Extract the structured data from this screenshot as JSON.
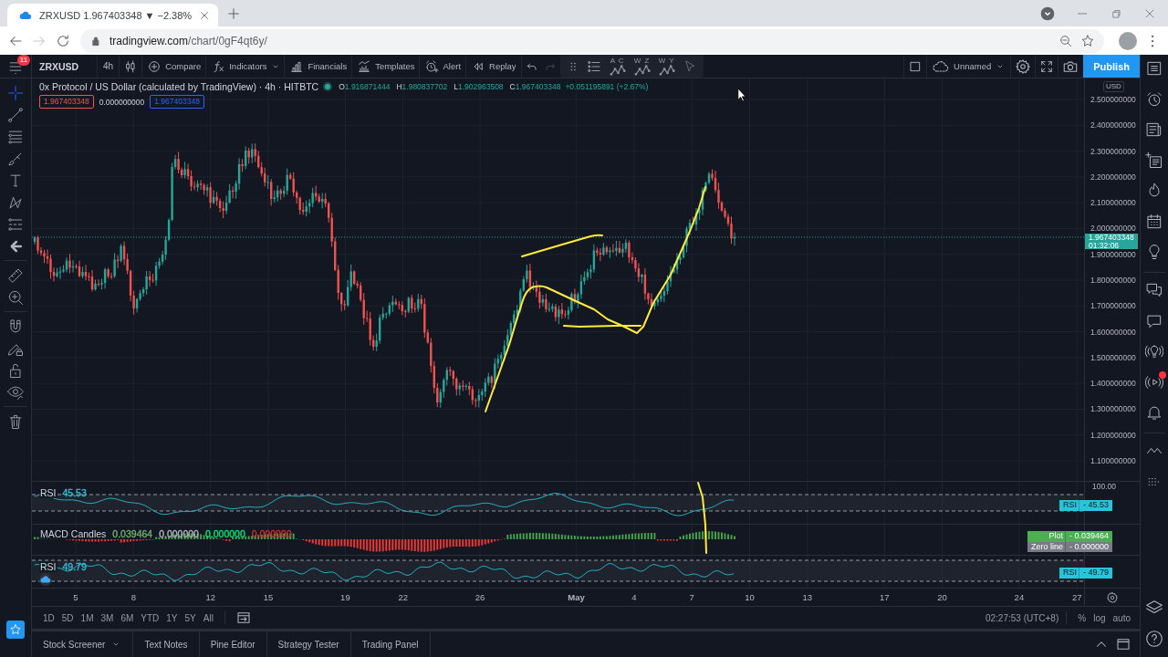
{
  "browser": {
    "tab": {
      "title": "ZRXUSD 1.967403348 ▼ −2.38%"
    },
    "nav": [
      {
        "kind": "back",
        "disabled": false
      },
      {
        "kind": "forward",
        "disabled": true
      },
      {
        "kind": "reload",
        "disabled": false
      }
    ],
    "url": {
      "host": "tradingview.com",
      "path": "/chart/0gF4qt6y/"
    }
  },
  "menu": {
    "badge": "11"
  },
  "left_tools": [
    {
      "tools": [
        {
          "kind": "crosshair",
          "selected": true
        },
        {
          "kind": "trend-line",
          "selected": false
        },
        {
          "kind": "horizontal-lines",
          "selected": false
        },
        {
          "kind": "brush",
          "selected": false
        },
        {
          "kind": "text-tool",
          "selected": false
        },
        {
          "kind": "zigzag-pattern",
          "selected": false
        },
        {
          "kind": "parallel-lines",
          "selected": false
        },
        {
          "kind": "arrow-left",
          "selected": false
        }
      ]
    },
    {
      "tools": [
        {
          "kind": "ruler",
          "selected": false
        },
        {
          "kind": "zoom-in",
          "selected": false
        }
      ]
    },
    {
      "tools": [
        {
          "kind": "magnet",
          "selected": false
        },
        {
          "kind": "pencil-lock",
          "selected": false
        },
        {
          "kind": "open-padlock",
          "selected": false
        },
        {
          "kind": "eye",
          "selected": false
        }
      ]
    },
    {
      "tools": [
        {
          "kind": "trash",
          "selected": false
        }
      ]
    }
  ],
  "favorites": {
    "on": true
  },
  "toolbar": {
    "symbol": "ZRXUSD",
    "interval": "4h",
    "actions": [
      {
        "kind": "compare",
        "label": "Compare",
        "dropdown": false
      },
      {
        "kind": "indicators",
        "label": "Indicators",
        "dropdown": true
      },
      {
        "kind": "financials",
        "label": "Financials",
        "dropdown": false
      },
      {
        "kind": "templates",
        "label": "Templates",
        "dropdown": false
      },
      {
        "kind": "alert",
        "label": "Alert",
        "dropdown": false
      },
      {
        "kind": "replay",
        "label": "Replay",
        "dropdown": false
      }
    ],
    "undo": {
      "disabled": false
    },
    "redo": {
      "disabled": true
    },
    "patterns": [
      {
        "letters": "A C"
      },
      {
        "letters": "W Z"
      },
      {
        "letters": "W Y"
      }
    ],
    "layout_name": "Unnamed",
    "publish": "Publish"
  },
  "legend": {
    "title": "0x Protocol / US Dollar (calculated by TradingView) · 4h · HITBTC",
    "ohlc": [
      {
        "label": "O",
        "value": "1.916871444"
      },
      {
        "label": "H",
        "value": "1.980837702"
      },
      {
        "label": "L",
        "value": "1.902963508"
      },
      {
        "label": "C",
        "value": "1.967403348"
      }
    ],
    "change": "+0.051195891 (+2.67%)",
    "quotes": [
      {
        "kind": "sell",
        "value": "1.967403348"
      },
      {
        "kind": "spread",
        "value": "0.000000000"
      },
      {
        "kind": "buy",
        "value": "1.967403348"
      }
    ]
  },
  "price_axis": {
    "currency": "USD",
    "labels": [
      "2.500000000",
      "2.400000000",
      "2.300000000",
      "2.200000000",
      "2.100000000",
      "2.000000000",
      "1.900000000",
      "1.800000000",
      "1.700000000",
      "1.600000000",
      "1.500000000",
      "1.400000000",
      "1.300000000",
      "1.200000000",
      "1.100000000"
    ],
    "last_price": {
      "value": "1.967403348",
      "countdown": "01:32:06"
    }
  },
  "indicators": [
    {
      "kind": "rsi",
      "name": "RSI",
      "values": [
        {
          "text": "45.53",
          "color": "#26c6da"
        }
      ],
      "axis_labels": [
        "100.00"
      ],
      "tags": [
        {
          "name": "RSI",
          "value": "- 45.53",
          "color": "#26c6da"
        }
      ],
      "cloud": false
    },
    {
      "kind": "macd",
      "name": "MACD Candles",
      "values": [
        {
          "text": "0.039464",
          "color": "#6fae6f"
        },
        {
          "text": "0.000000",
          "color": "#b2b5be"
        },
        {
          "text": "0.000000",
          "color": "#00e676"
        },
        {
          "text": "0.000000",
          "color": "#d32f2f"
        }
      ],
      "tags": [
        {
          "name": "Plot",
          "value": "- 0.039464",
          "color": "#4caf50"
        },
        {
          "name": "Zero line",
          "value": "- 0.000000",
          "color": "#787b86"
        }
      ],
      "cloud": false
    },
    {
      "kind": "rsi",
      "name": "RSI",
      "values": [
        {
          "text": "49.79",
          "color": "#26c6da"
        }
      ],
      "tags": [
        {
          "name": "RSI",
          "value": "- 49.79",
          "color": "#26c6da"
        }
      ],
      "cloud": true
    }
  ],
  "time_axis": {
    "labels": [
      {
        "text": "5",
        "kind": "day"
      },
      {
        "text": "8",
        "kind": "day"
      },
      {
        "text": "12",
        "kind": "day"
      },
      {
        "text": "15",
        "kind": "day"
      },
      {
        "text": "19",
        "kind": "day"
      },
      {
        "text": "22",
        "kind": "day"
      },
      {
        "text": "26",
        "kind": "day"
      },
      {
        "text": "May",
        "kind": "month"
      },
      {
        "text": "4",
        "kind": "day"
      },
      {
        "text": "7",
        "kind": "day"
      },
      {
        "text": "10",
        "kind": "day"
      },
      {
        "text": "13",
        "kind": "day"
      },
      {
        "text": "17",
        "kind": "day"
      },
      {
        "text": "20",
        "kind": "day"
      },
      {
        "text": "24",
        "kind": "day"
      },
      {
        "text": "27",
        "kind": "day"
      }
    ]
  },
  "ranges": [
    {
      "label": "1D",
      "selected": false
    },
    {
      "label": "5D",
      "selected": false
    },
    {
      "label": "1M",
      "selected": false
    },
    {
      "label": "3M",
      "selected": false
    },
    {
      "label": "6M",
      "selected": false
    },
    {
      "label": "YTD",
      "selected": false
    },
    {
      "label": "1Y",
      "selected": false
    },
    {
      "label": "5Y",
      "selected": false
    },
    {
      "label": "All",
      "selected": false
    }
  ],
  "clock": "02:27:53 (UTC+8)",
  "scale_options": [
    {
      "label": "%",
      "selected": false
    },
    {
      "label": "log",
      "selected": false
    },
    {
      "label": "auto",
      "selected": false
    }
  ],
  "bottom_tabs": [
    {
      "label": "Stock Screener",
      "dropdown": true,
      "selected": false
    },
    {
      "label": "Text Notes",
      "dropdown": false,
      "selected": false
    },
    {
      "label": "Pine Editor",
      "dropdown": false,
      "selected": false
    },
    {
      "label": "Strategy Tester",
      "dropdown": false,
      "selected": false
    },
    {
      "label": "Trading Panel",
      "dropdown": false,
      "selected": false
    }
  ],
  "right_tools": [
    {
      "tools": [
        {
          "kind": "list",
          "notification": false
        },
        {
          "kind": "alarm-clock",
          "notification": false
        },
        {
          "kind": "newspaper",
          "notification": false
        },
        {
          "kind": "list-plus",
          "notification": false
        },
        {
          "kind": "flame",
          "notification": false
        },
        {
          "kind": "calendar",
          "notification": false
        },
        {
          "kind": "lightbulb",
          "notification": false
        }
      ]
    },
    {
      "tools": [
        {
          "kind": "chat-bubbles",
          "notification": false
        },
        {
          "kind": "chat-bubble",
          "notification": false
        },
        {
          "kind": "broadcast-lightbulb",
          "notification": false
        },
        {
          "kind": "broadcast-play",
          "notification": true
        },
        {
          "kind": "bell",
          "notification": false
        }
      ]
    },
    {
      "tools": [
        {
          "kind": "zigzag",
          "notification": false
        },
        {
          "kind": "dots-grid",
          "notification": false
        }
      ]
    }
  ],
  "right_bottom_tools": [
    {
      "kind": "layers"
    },
    {
      "kind": "help"
    }
  ]
}
